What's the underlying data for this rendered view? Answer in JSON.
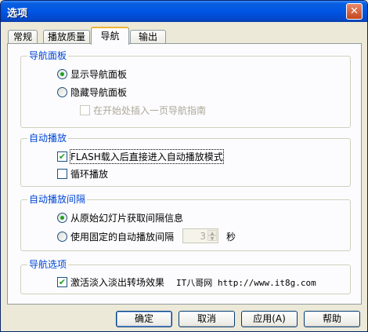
{
  "window": {
    "title": "选项",
    "close_glyph": "✕"
  },
  "tabs": [
    {
      "label": "常规"
    },
    {
      "label": "播放质量"
    },
    {
      "label": "导航",
      "selected": true
    },
    {
      "label": "输出"
    }
  ],
  "nav_panel": {
    "label": "导航面板",
    "show_panel": {
      "label": "显示导航面板",
      "selected": true
    },
    "hide_panel": {
      "label": "隐藏导航面板",
      "selected": false
    },
    "insert_guide": {
      "label": "在开始处插入一页导航指南",
      "checked": false,
      "enabled": false
    }
  },
  "autoplay": {
    "label": "自动播放",
    "flash_auto": {
      "label": "FLASH载入后直接进入自动播放模式",
      "checked": true
    },
    "loop": {
      "label": "循环播放",
      "checked": false
    }
  },
  "autoplay_interval": {
    "label": "自动播放间隔",
    "from_source": {
      "label": "从原始幻灯片获取间隔信息",
      "selected": true
    },
    "fixed": {
      "label": "使用固定的自动播放间隔",
      "selected": false
    },
    "interval_value": "3",
    "unit": "秒"
  },
  "nav_options": {
    "label": "导航选项",
    "fade_effect": {
      "label": "激活淡入淡出转场效果",
      "checked": true
    }
  },
  "watermark": "IT八哥网 http://www.it8g.com",
  "buttons": {
    "ok": "确定",
    "cancel": "取消",
    "apply": "应用(A)",
    "help": "帮助"
  },
  "icons": {
    "check": "✔",
    "up": "▲",
    "down": "▼"
  }
}
